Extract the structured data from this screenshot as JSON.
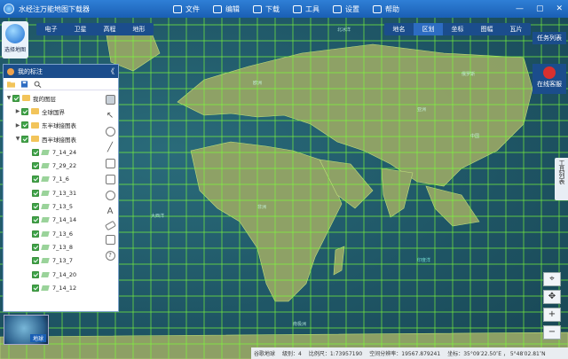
{
  "app": {
    "title": "水经注万能地图下载器"
  },
  "menu": {
    "items": [
      {
        "label": "文件",
        "icon": "file-icon"
      },
      {
        "label": "编辑",
        "icon": "edit-icon"
      },
      {
        "label": "下载",
        "icon": "download-icon"
      },
      {
        "label": "工具",
        "icon": "tools-icon"
      },
      {
        "label": "设置",
        "icon": "settings-icon"
      },
      {
        "label": "帮助",
        "icon": "help-icon"
      }
    ]
  },
  "window_controls": {
    "minimize": "—",
    "maximize": "▢",
    "close": "✕"
  },
  "logo": {
    "label": "选择地图"
  },
  "map_tabs": [
    "电子",
    "卫星",
    "高程",
    "地形"
  ],
  "right_tabs": {
    "items": [
      "地名",
      "区划",
      "坐标",
      "图幅",
      "瓦片"
    ],
    "active": "区划"
  },
  "task_list": {
    "label": "任务列表"
  },
  "support": {
    "label": "在线客服"
  },
  "tool_list": {
    "label": "工具列表"
  },
  "panel": {
    "title": "我的标注",
    "collapse": "《",
    "tree": [
      {
        "label": "我的图层",
        "level": 0,
        "type": "folder",
        "expanded": true
      },
      {
        "label": "全球国界",
        "level": 1,
        "type": "folder",
        "expanded": false
      },
      {
        "label": "东半球接图表",
        "level": 1,
        "type": "folder",
        "expanded": false
      },
      {
        "label": "西半球接图表",
        "level": 1,
        "type": "folder",
        "expanded": true
      },
      {
        "label": "7_14_24",
        "level": 2,
        "type": "leaf"
      },
      {
        "label": "7_29_22",
        "level": 2,
        "type": "leaf"
      },
      {
        "label": "7_1_6",
        "level": 2,
        "type": "leaf"
      },
      {
        "label": "7_13_31",
        "level": 2,
        "type": "leaf"
      },
      {
        "label": "7_13_5",
        "level": 2,
        "type": "leaf"
      },
      {
        "label": "7_14_14",
        "level": 2,
        "type": "leaf"
      },
      {
        "label": "7_13_6",
        "level": 2,
        "type": "leaf"
      },
      {
        "label": "7_13_8",
        "level": 2,
        "type": "leaf"
      },
      {
        "label": "7_13_7",
        "level": 2,
        "type": "leaf"
      },
      {
        "label": "7_14_20",
        "level": 2,
        "type": "leaf"
      },
      {
        "label": "7_14_12",
        "level": 2,
        "type": "leaf"
      }
    ],
    "side_tools": [
      "hand-icon",
      "pointer-icon",
      "marker-icon",
      "line-icon",
      "polygon-icon",
      "rectangle-icon",
      "circle-icon",
      "text-icon",
      "eraser-icon",
      "print-icon",
      "help-icon"
    ]
  },
  "globe": {
    "label": "地球"
  },
  "zoom_controls": [
    "⌖",
    "✥",
    "+",
    "−"
  ],
  "status": {
    "source": "谷歌地球",
    "level_label": "级别：",
    "level": "4",
    "scale_label": "比例尺：",
    "scale": "1:73957190",
    "resolution_label": "空间分辨率：",
    "resolution": "19567.879241",
    "coord_label": "坐标：",
    "coord": "35°09′22.50″E ， 5°48′02.81″N"
  },
  "map_labels": [
    {
      "text": "北冰洋"
    },
    {
      "text": "欧洲"
    },
    {
      "text": "亚洲"
    },
    {
      "text": "非洲"
    },
    {
      "text": "大西洋"
    },
    {
      "text": "印度洋"
    },
    {
      "text": "南极洲"
    },
    {
      "text": "俄罗斯"
    },
    {
      "text": "中国"
    }
  ],
  "colors": {
    "grid": "#7dff3a",
    "land": "#9fae6a",
    "title_bar": "#1a5fb4",
    "panel_head": "#1b4d8c"
  }
}
